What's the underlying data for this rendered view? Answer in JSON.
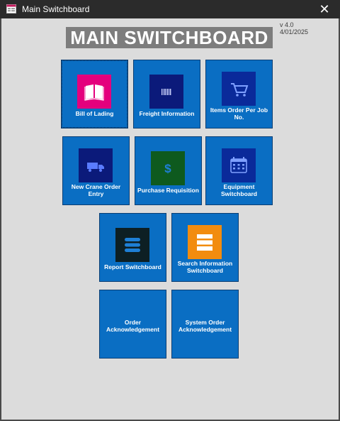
{
  "window": {
    "title": "Main Switchboard",
    "icon": "form-icon",
    "close_icon": "close-icon",
    "close_glyph": "✕"
  },
  "header": {
    "title": "MAIN SWITCHBOARD",
    "version": "v 4.0",
    "date": "4/01/2025"
  },
  "tiles": {
    "bill_of_lading": {
      "label": "Bill of Lading",
      "icon": "book-icon",
      "icon_color": "#e4007d"
    },
    "freight_information": {
      "label": "Freight Information",
      "icon": "barcode-icon",
      "icon_color": "#0b1a7a"
    },
    "items_order": {
      "label": "Items Order Per Job No.",
      "icon": "shopping-cart-icon",
      "icon_color": "#0a2a9a"
    },
    "new_crane_order": {
      "label": "New Crane Order Entry",
      "icon": "truck-icon",
      "icon_color": "#0b1a7a"
    },
    "purchase_requisition": {
      "label": "Purchase Requisition",
      "icon": "dollar-icon",
      "icon_color": "#0e5a1e"
    },
    "equipment_switchboard": {
      "label": "Equipment Switchboard",
      "icon": "calendar-icon",
      "icon_color": "#0a2a9a"
    },
    "report_switchboard": {
      "label": "Report Switchboard",
      "icon": "stack-icon",
      "icon_color": "#0d1f24"
    },
    "search_information": {
      "label": "Search Information Switchboard",
      "icon": "list-icon",
      "icon_color": "#f28c0f"
    },
    "order_acknowledgement": {
      "label": "Order Acknowledgement"
    },
    "system_order_acknowledgement": {
      "label": "System Order Acknowledgement"
    }
  },
  "colors": {
    "tile_blue": "#0a6ec3",
    "title_bg": "#7d7d7d",
    "client_bg": "#dcdcdc"
  }
}
